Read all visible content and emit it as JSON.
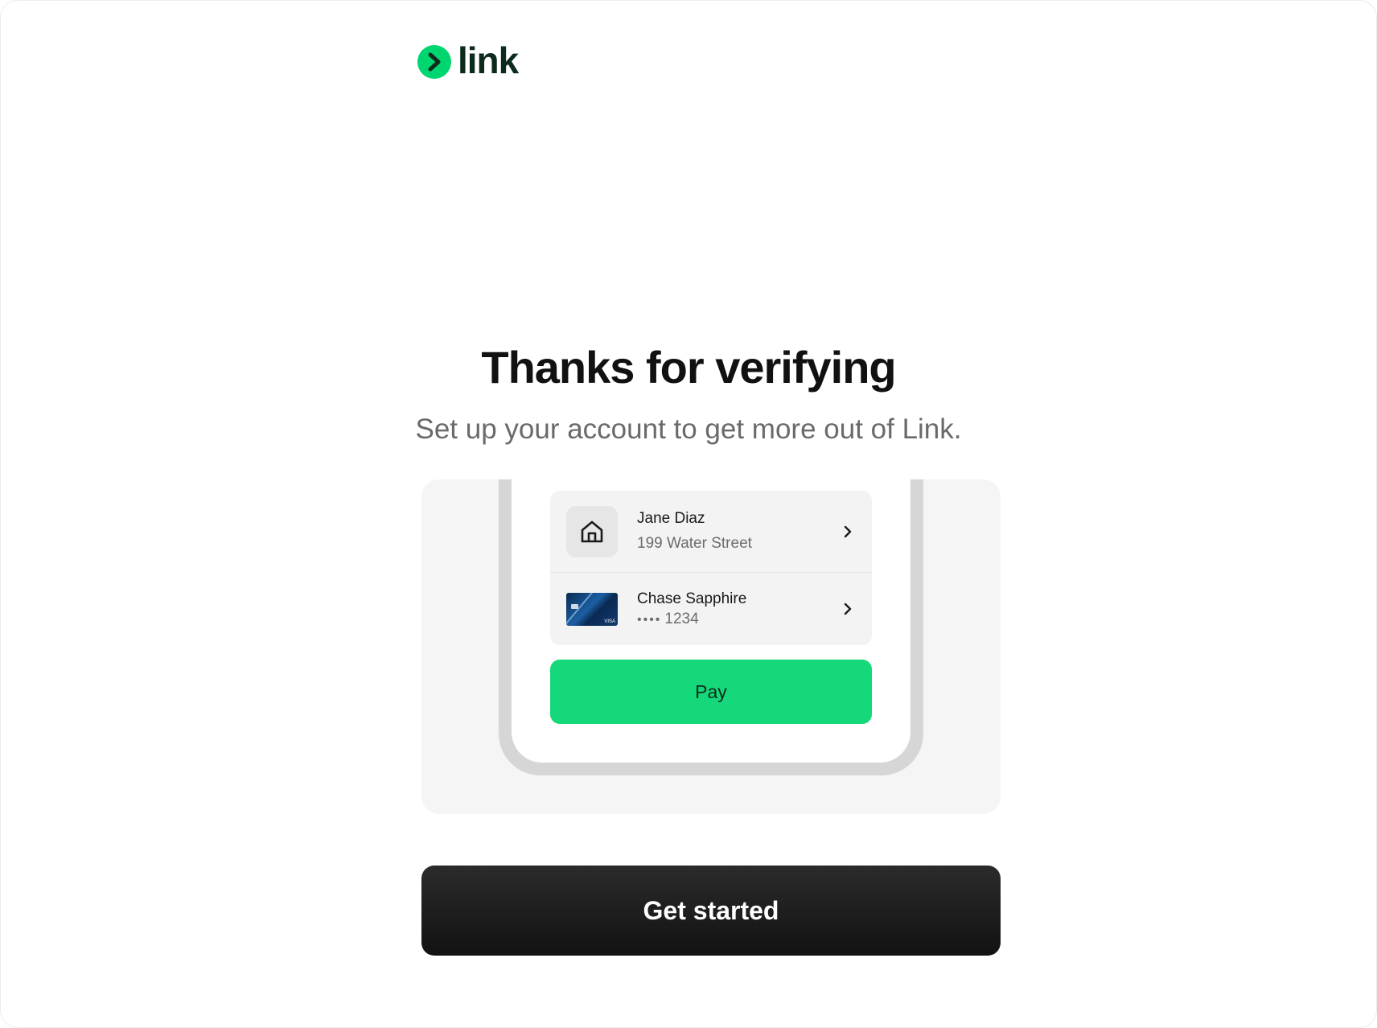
{
  "brand": {
    "name": "link",
    "logo_icon": "chevron-right-circle-icon",
    "accent_color": "#00d66f",
    "text_color": "#0d2b1c"
  },
  "main": {
    "title": "Thanks for verifying",
    "subtitle": "Set up your account to get more out of Link."
  },
  "illustration": {
    "address": {
      "icon": "home-icon",
      "name": "Jane Diaz",
      "street": "199 Water Street"
    },
    "payment": {
      "icon": "credit-card-icon",
      "card_brand": "VISA",
      "name": "Chase Sapphire",
      "masked_dots": "••••",
      "last4": "1234"
    },
    "pay_label": "Pay",
    "pay_color": "#14d87a"
  },
  "cta": {
    "label": "Get started",
    "color": "#1a1a1a"
  }
}
